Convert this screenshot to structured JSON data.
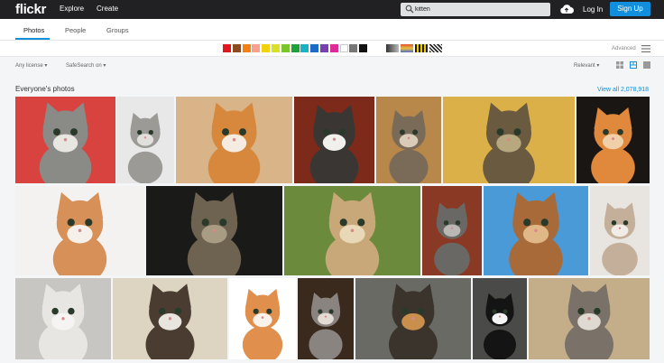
{
  "header": {
    "logo": "flickr",
    "explore": "Explore",
    "create": "Create",
    "search_value": "kitten",
    "login": "Log In",
    "signup": "Sign Up"
  },
  "tabs": [
    {
      "label": "Photos"
    },
    {
      "label": "People"
    },
    {
      "label": "Groups"
    }
  ],
  "color_filters": [
    "#e0181d",
    "#8c4a20",
    "#f57f12",
    "#f9a08f",
    "#f2d20c",
    "#d8e028",
    "#7cc52c",
    "#1ea23c",
    "#19b2c4",
    "#1c6cc7",
    "#7a3fb0",
    "#dd2c98",
    "#ffffff",
    "#777777",
    "#111111"
  ],
  "advanced_label": "Advanced",
  "filters": {
    "license": "Any license",
    "safesearch": "SafeSearch on",
    "sort": "Relevant"
  },
  "section": {
    "title": "Everyone's photos",
    "view_all": "View all 2,078,918"
  },
  "photos": [
    {
      "bg": "#d9433f",
      "fur": "#8a8a86",
      "fur2": "#e8e6e1"
    },
    {
      "bg": "#e8e8e8",
      "fur": "#9c9a96",
      "fur2": "#e2e0dc"
    },
    {
      "bg": "#d8b488",
      "fur": "#d7883c",
      "fur2": "#f4ece0"
    },
    {
      "bg": "#7d2a1a",
      "fur": "#3a3634",
      "fur2": "#f2f0ec"
    },
    {
      "bg": "#b8874a",
      "fur": "#7a6a58",
      "fur2": "#d8ccb8"
    },
    {
      "bg": "#dcb048",
      "fur": "#6a5a40",
      "fur2": "#b8a880"
    },
    {
      "bg": "#1a1614",
      "fur": "#e0883c",
      "fur2": "#f0d0a8"
    },
    {
      "bg": "#f4f2f0",
      "fur": "#d69058",
      "fur2": "#f6f0ea"
    },
    {
      "bg": "#1a1a18",
      "fur": "#6e6250",
      "fur2": "#a89c84"
    },
    {
      "bg": "#6b8a3c",
      "fur": "#c8a878",
      "fur2": "#e8d8b8"
    },
    {
      "bg": "#8a3a24",
      "fur": "#6a6864",
      "fur2": "#bab8b4"
    },
    {
      "bg": "#4a9ad8",
      "fur": "#a86a38",
      "fur2": "#e0b888"
    },
    {
      "bg": "#e8e4e0",
      "fur": "#c4b09a",
      "fur2": "#f2ece6"
    },
    {
      "bg": "#c8c6c2",
      "fur": "#e8e6e2",
      "fur2": "#f6f4f2"
    },
    {
      "bg": "#ddd4c2",
      "fur": "#4a3c30",
      "fur2": "#e8e4de"
    },
    {
      "bg": "#ffffff",
      "fur": "#e0904c",
      "fur2": "#f8f2ea"
    },
    {
      "bg": "#3a2a1e",
      "fur": "#8a8480",
      "fur2": "#e2dcd4"
    },
    {
      "bg": "#6a6a64",
      "fur": "#3a342c",
      "fur2": "#c8904c"
    },
    {
      "bg": "#4a4a48",
      "fur": "#141414",
      "fur2": "#f4f4f4"
    },
    {
      "bg": "#c4ae8a",
      "fur": "#7a7268",
      "fur2": "#dedad2"
    }
  ]
}
